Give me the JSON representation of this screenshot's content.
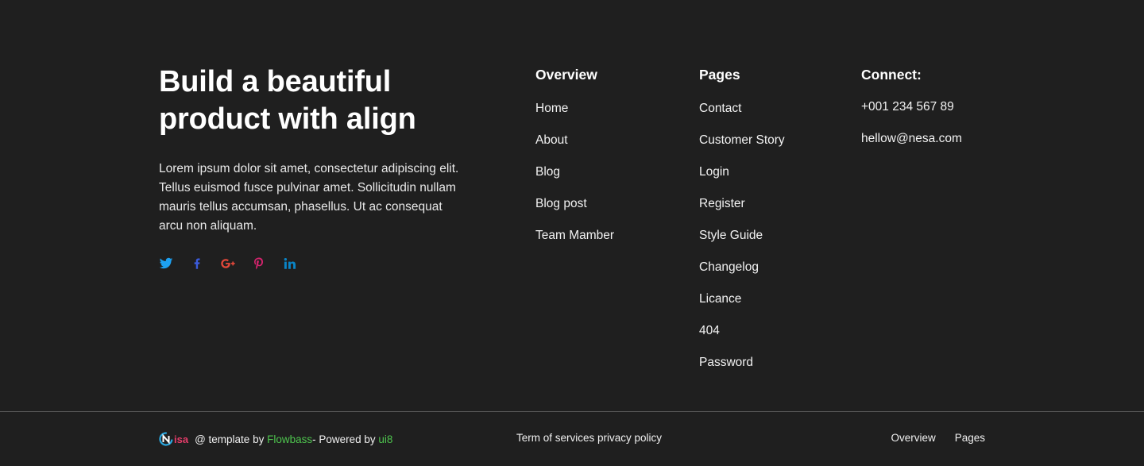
{
  "brand": {
    "headline": "Build a beautiful\nproduct with align",
    "description": "Lorem ipsum dolor sit amet, consectetur adipiscing elit. Tellus euismod fusce pulvinar amet. Sollicitudin nullam mauris tellus accumsan, phasellus. Ut ac consequat arcu non aliquam.",
    "socials": [
      {
        "icon": "twitter-icon",
        "color": "#1da1f2"
      },
      {
        "icon": "facebook-icon",
        "color": "#3b5bdb"
      },
      {
        "icon": "google-plus-icon",
        "color": "#e5483a"
      },
      {
        "icon": "pinterest-icon",
        "color": "#d6246e"
      },
      {
        "icon": "linkedin-icon",
        "color": "#0a84c6"
      }
    ]
  },
  "columns": {
    "overview": {
      "title": "Overview",
      "items": [
        "Home",
        "About",
        "Blog",
        "Blog post",
        "Team Mamber"
      ]
    },
    "pages": {
      "title": "Pages",
      "items": [
        "Contact",
        "Customer Story",
        "Login",
        "Register",
        "Style Guide",
        "Changelog",
        "Licance",
        "404",
        "Password"
      ]
    },
    "connect": {
      "title": "Connect:",
      "items": [
        "+001 234 567 89",
        "hellow@nesa.com"
      ]
    }
  },
  "bottom": {
    "logo_text": "isa",
    "credit_prefix": "@ template by ",
    "credit_link1": "Flowbass",
    "credit_middle": "- Powered by ",
    "credit_link2": "ui8",
    "legal": "Term of services privacy policy",
    "nav": [
      "Overview",
      "Pages"
    ]
  },
  "colors": {
    "background": "#1f1f1f",
    "link_green": "#4ec44e",
    "logo_pink": "#e63d6a",
    "logo_blue": "#2aa8e0"
  }
}
